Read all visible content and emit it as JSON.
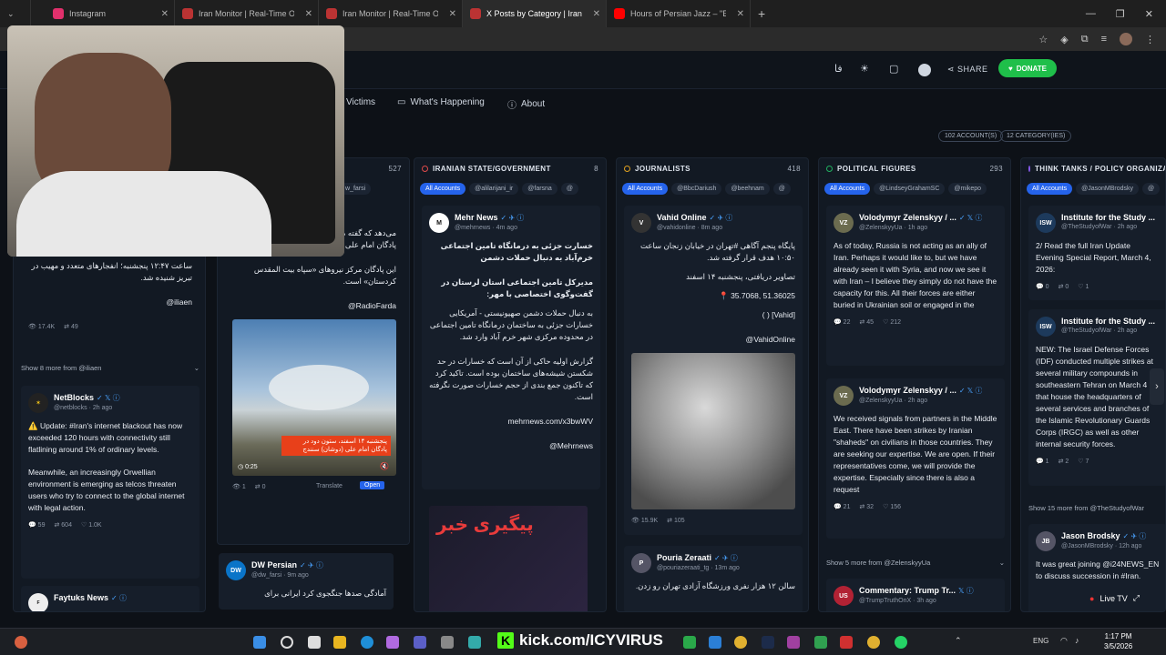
{
  "browser": {
    "tabs": [
      {
        "label": "Instagram",
        "color": "#e1306c"
      },
      {
        "label": "Iran Monitor | Real-Time OSINT",
        "color": "#b33"
      },
      {
        "label": "Iran Monitor | Real-Time OSINT",
        "color": "#b33"
      },
      {
        "label": "X Posts by Category | Iran Monitor",
        "color": "#b33"
      },
      {
        "label": "Hours of Persian Jazz – \"Emshab\"",
        "color": "#ff0000"
      }
    ]
  },
  "header": {
    "lang": "فا",
    "share": "SHARE",
    "donate": "DONATE"
  },
  "nav": {
    "victims": "Victims",
    "whats_happening": "What's Happening",
    "about": "About"
  },
  "badges": {
    "accounts": "102 ACCOUNT(S)",
    "categories": "12 CATEGORY(IES)"
  },
  "columns": {
    "col1": {
      "count": "527",
      "chip": "w_farsi"
    },
    "state": {
      "title": "IRANIAN STATE/GOVERNMENT",
      "count": "8",
      "chips": [
        "All Accounts",
        "@alilarijani_ir",
        "@farsna",
        "@"
      ],
      "color": "#e04a4a"
    },
    "journalists": {
      "title": "JOURNALISTS",
      "count": "418",
      "chips": [
        "All Accounts",
        "@BbcDariush",
        "@beehnam",
        "@"
      ],
      "color": "#e0a020"
    },
    "political": {
      "title": "POLITICAL FIGURES",
      "count": "293",
      "chips": [
        "All Accounts",
        "@LindseyGrahamSC",
        "@mikepo"
      ],
      "color": "#20b060"
    },
    "think": {
      "title": "THINK TANKS / POLICY ORGANIZA",
      "count": "",
      "chips": [
        "All Accounts",
        "@JasonMBrodsky",
        "@"
      ],
      "color": "#8a5cf0"
    }
  },
  "posts": {
    "c0a": {
      "text1": "ساعت ۱۲:۴۷ پنجشنبه؛ انفجارهای متعدد و مهیب در تبریز شنیده شد.",
      "sign": "iliaen@",
      "views": "17.4K",
      "rt": "49"
    },
    "c0more": "Show 8 more from @iliaen",
    "c0b": {
      "name": "NetBlocks",
      "handle": "@netblocks · 2h ago",
      "t1": "⚠️ Update: #Iran's internet blackout has now exceeded 120 hours with connectivity still flatlining around 1% of ordinary levels.",
      "t2": "Meanwhile, an increasingly Orwellian environment is emerging as telcos threaten users who try to connect to the global internet with legal action.",
      "s1": "59",
      "s2": "604",
      "s3": "1.0K"
    },
    "c0c": {
      "name": "Faytuks News"
    },
    "c1a": {
      "t0": "تصاویر م",
      "t0b": "ستون دودی د",
      "t1": "می‌دهد که گفته می‌شود ناشی از حمله هوایی به پادگان امام علی (دوشان) است.",
      "t2": "این پادگان مرکز نیروهای «سپاه بیت المقدس کردستان» است.",
      "sign": "RadioFarda@",
      "caption": "پنجشنبه ۱۴ اسفند، ستون دود در پادگان امام علی (دوشان) سنندج",
      "dur": "0:25",
      "s1": "1",
      "s2": "0",
      "translate": "Translate",
      "open": "Open"
    },
    "c1b": {
      "name": "DW Persian",
      "handle": "@dw_farsi · 9m ago",
      "t1": "آمادگی صدها جنگجوی کرد ایرانی برای"
    },
    "c2a": {
      "name": "Mehr News",
      "handle": "@mehrnews · 4m ago",
      "h1": "خسارت جزئی به درمانگاه تامین اجتماعی خرم‌آباد به دنبال حملات دشمن",
      "h2": "مدیرکل تامین اجتماعی استان لرستان در گفت‌وگوی اختصاصی با مهر:",
      "t1": "به دنبال حملات دشمن صهیونیستی - آمریکایی خسارات جزئی به ساختمان درمانگاه تامین اجتماعی در محدوده مرکزی شهر خرم آباد وارد شد.",
      "t2": "گزارش اولیه حاکی از آن است که خسارات در حد شکستن شیشه‌های ساختمان بوده است. تاکید کرد که تاکنون جمع بندی از حجم خسارات صورت نگرفته است.",
      "link": "mehrnews.com/x3bwWV",
      "sign": "Mehrnews@",
      "img_text": "پیگیری خبر"
    },
    "c3a": {
      "name": "Vahid Online",
      "handle": "@vahidonline · 8m ago",
      "t1": "پایگاه پنجم آگاهی #تهران در خیابان زنجان ساعت ۱۰:۵۰ هدف قرار گرفته شد.",
      "t2": "تصاویر دریافتی، پنجشنبه ۱۴ اسفند",
      "t3": "51.36025 ,35.7068 📍",
      "t4": "[Vahid] ( )",
      "sign": "VahidOnline@",
      "s1": "15.9K",
      "s2": "105"
    },
    "c3b": {
      "name": "Pouria Zeraati",
      "handle": "@pouriazeraati_tg · 13m ago",
      "t1": "سالن ۱۲ هزار نفری ورزشگاه آزادی تهران رو زدن."
    },
    "c4a": {
      "name": "Volodymyr Zelenskyy / ...",
      "handle": "@ZelenskyyUa · 1h ago",
      "t1": "As of today, Russia is not acting as an ally of Iran. Perhaps it would like to, but we have already seen it with Syria, and now we see it with Iran – I believe they simply do not have the capacity for this. All their forces are either buried in Ukrainian soil or engaged in the",
      "s1": "22",
      "s2": "45",
      "s3": "212"
    },
    "c4b": {
      "name": "Volodymyr Zelenskyy / ...",
      "handle": "@ZelenskyyUa · 2h ago",
      "t1": "We received signals from partners in the Middle East. There have been strikes by Iranian \"shaheds\" on civilians in those countries. They are seeking our expertise. We are open. If their representatives come, we will provide the expertise. Especially since there is also a request",
      "s1": "21",
      "s2": "32",
      "s3": "156"
    },
    "c4more": "Show 5 more from @ZelenskyyUa",
    "c4c": {
      "name": "Commentary: Trump Tr...",
      "handle": "@TrumpTruthOnX · 3h ago"
    },
    "c5a": {
      "name": "Institute for the Study ...",
      "handle": "@TheStudyofWar · 2h ago",
      "t1": "2/ Read the full Iran Update Evening Special Report, March 4, 2026:",
      "s1": "0",
      "s2": "0",
      "s3": "1"
    },
    "c5b": {
      "name": "Institute for the Study ...",
      "handle": "@TheStudyofWar · 2h ago",
      "t1": "NEW: The Israel Defense Forces (IDF) conducted multiple strikes at several military compounds in southeastern Tehran on March 4 that house the headquarters of several services and branches of the Islamic Revolutionary Guards Corps (IRGC) as well as other internal security forces.",
      "s1": "1",
      "s2": "2",
      "s3": "7"
    },
    "c5more": "Show 15 more from @TheStudyofWar",
    "c5c": {
      "name": "Jason Brodsky",
      "handle": "@JasonMBrodsky · 12h ago",
      "t1": "It was great joining @i24NEWS_EN to discuss succession in #Iran."
    }
  },
  "livetv": "Live TV",
  "taskbar": {
    "kick": "kick.com/ICYVIRUS",
    "lang": "ENG",
    "time": "1:17 PM",
    "date": "3/5/2026"
  }
}
